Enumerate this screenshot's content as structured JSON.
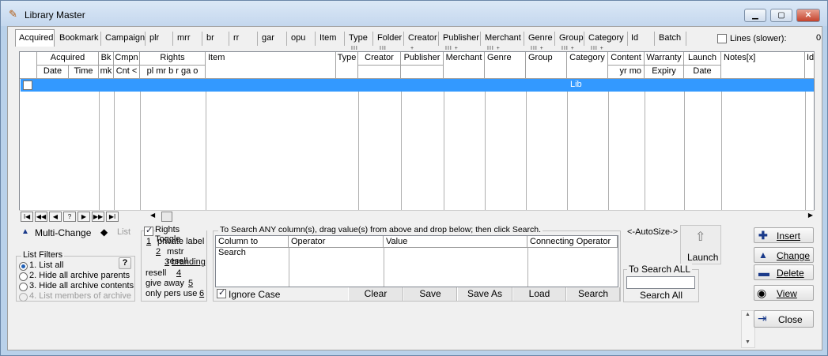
{
  "window": {
    "title": "Library Master",
    "min_label": "▁",
    "max_label": "▢",
    "close_label": "✕"
  },
  "tabs": [
    {
      "label": "Acquired",
      "marks": ""
    },
    {
      "label": "Bookmark",
      "marks": ""
    },
    {
      "label": "Campaign",
      "marks": ""
    },
    {
      "label": "plr",
      "marks": ""
    },
    {
      "label": "mrr",
      "marks": ""
    },
    {
      "label": "br",
      "marks": ""
    },
    {
      "label": "rr",
      "marks": ""
    },
    {
      "label": "gar",
      "marks": ""
    },
    {
      "label": "opu",
      "marks": ""
    },
    {
      "label": "Item",
      "marks": ""
    },
    {
      "label": "Type",
      "marks": "III"
    },
    {
      "label": "Folder",
      "marks": "III"
    },
    {
      "label": "Creator",
      "marks": "+"
    },
    {
      "label": "Publisher",
      "marks": "III   +"
    },
    {
      "label": "Merchant",
      "marks": "III   +"
    },
    {
      "label": "Genre",
      "marks": "III   +"
    },
    {
      "label": "Group",
      "marks": "III   +"
    },
    {
      "label": "Category",
      "marks": "III   +"
    },
    {
      "label": "Id",
      "marks": ""
    },
    {
      "label": "Batch",
      "marks": ""
    }
  ],
  "lines_slower": {
    "label": "Lines (slower):",
    "value": "0",
    "checked": false
  },
  "grid": {
    "group_headers": {
      "acquired": "Acquired",
      "bk": "Bk",
      "cmpn": "Cmpn",
      "rights": "Rights",
      "item": "Item",
      "type": "Type",
      "creator": "Creator",
      "publisher": "Publisher",
      "merchant": "Merchant",
      "genre": "Genre",
      "group": "Group",
      "category": "Category",
      "content": "Content",
      "warranty": "Warranty",
      "launch": "Launch",
      "notes": "Notes[x]",
      "id": "Id"
    },
    "sub_headers": {
      "date": "Date",
      "time": "Time",
      "mk": "mk",
      "cnt": "Cnt <",
      "rights_sub": "pl mr  b   r  ga  o",
      "yr_mo": "yr   mo",
      "expiry": "Expiry",
      "launch_date": "Date"
    },
    "selected_row": {
      "category": "Lib"
    }
  },
  "nav": {
    "first": "I◀",
    "prev_page": "◀◀",
    "prev": "◀",
    "help": "?",
    "next": "▶",
    "next_page": "▶▶",
    "last": "▶I"
  },
  "multi_change": {
    "label": "Multi-Change",
    "list_label": "List"
  },
  "list_filters": {
    "title": "List Filters",
    "help": "?",
    "options": [
      "1. List all",
      "2. Hide all archive parents",
      "3. Hide all archive contents",
      "4. List members of archive"
    ],
    "selected": 0
  },
  "rights_toggle": {
    "label": "Rights Toggle",
    "checked": true,
    "items": [
      {
        "key": "1",
        "label": "private label"
      },
      {
        "key": "2",
        "label": "mstr resell"
      },
      {
        "key": "3",
        "label": "branding"
      },
      {
        "key": "4",
        "label": "resell"
      },
      {
        "key": "5",
        "label": "give away"
      },
      {
        "key": "6",
        "label": "only pers use"
      }
    ]
  },
  "search": {
    "instruction": "To Search ANY column(s), drag value(s) from above and drop below; then click Search.",
    "columns": [
      "Column to Search",
      "Operator",
      "Value",
      "Connecting Operator"
    ],
    "ignore_case": {
      "label": "Ignore Case",
      "checked": true
    },
    "buttons": {
      "clear": "Clear",
      "save": "Save",
      "save_as": "Save As",
      "load": "Load",
      "search": "Search"
    }
  },
  "autosize": "<-AutoSize->",
  "launch": "Launch",
  "search_all": {
    "title": "To Search ALL",
    "button": "Search All",
    "value": ""
  },
  "actions": {
    "insert": "Insert",
    "change": "Change",
    "delete": "Delete",
    "view": "View",
    "close": "Close"
  }
}
